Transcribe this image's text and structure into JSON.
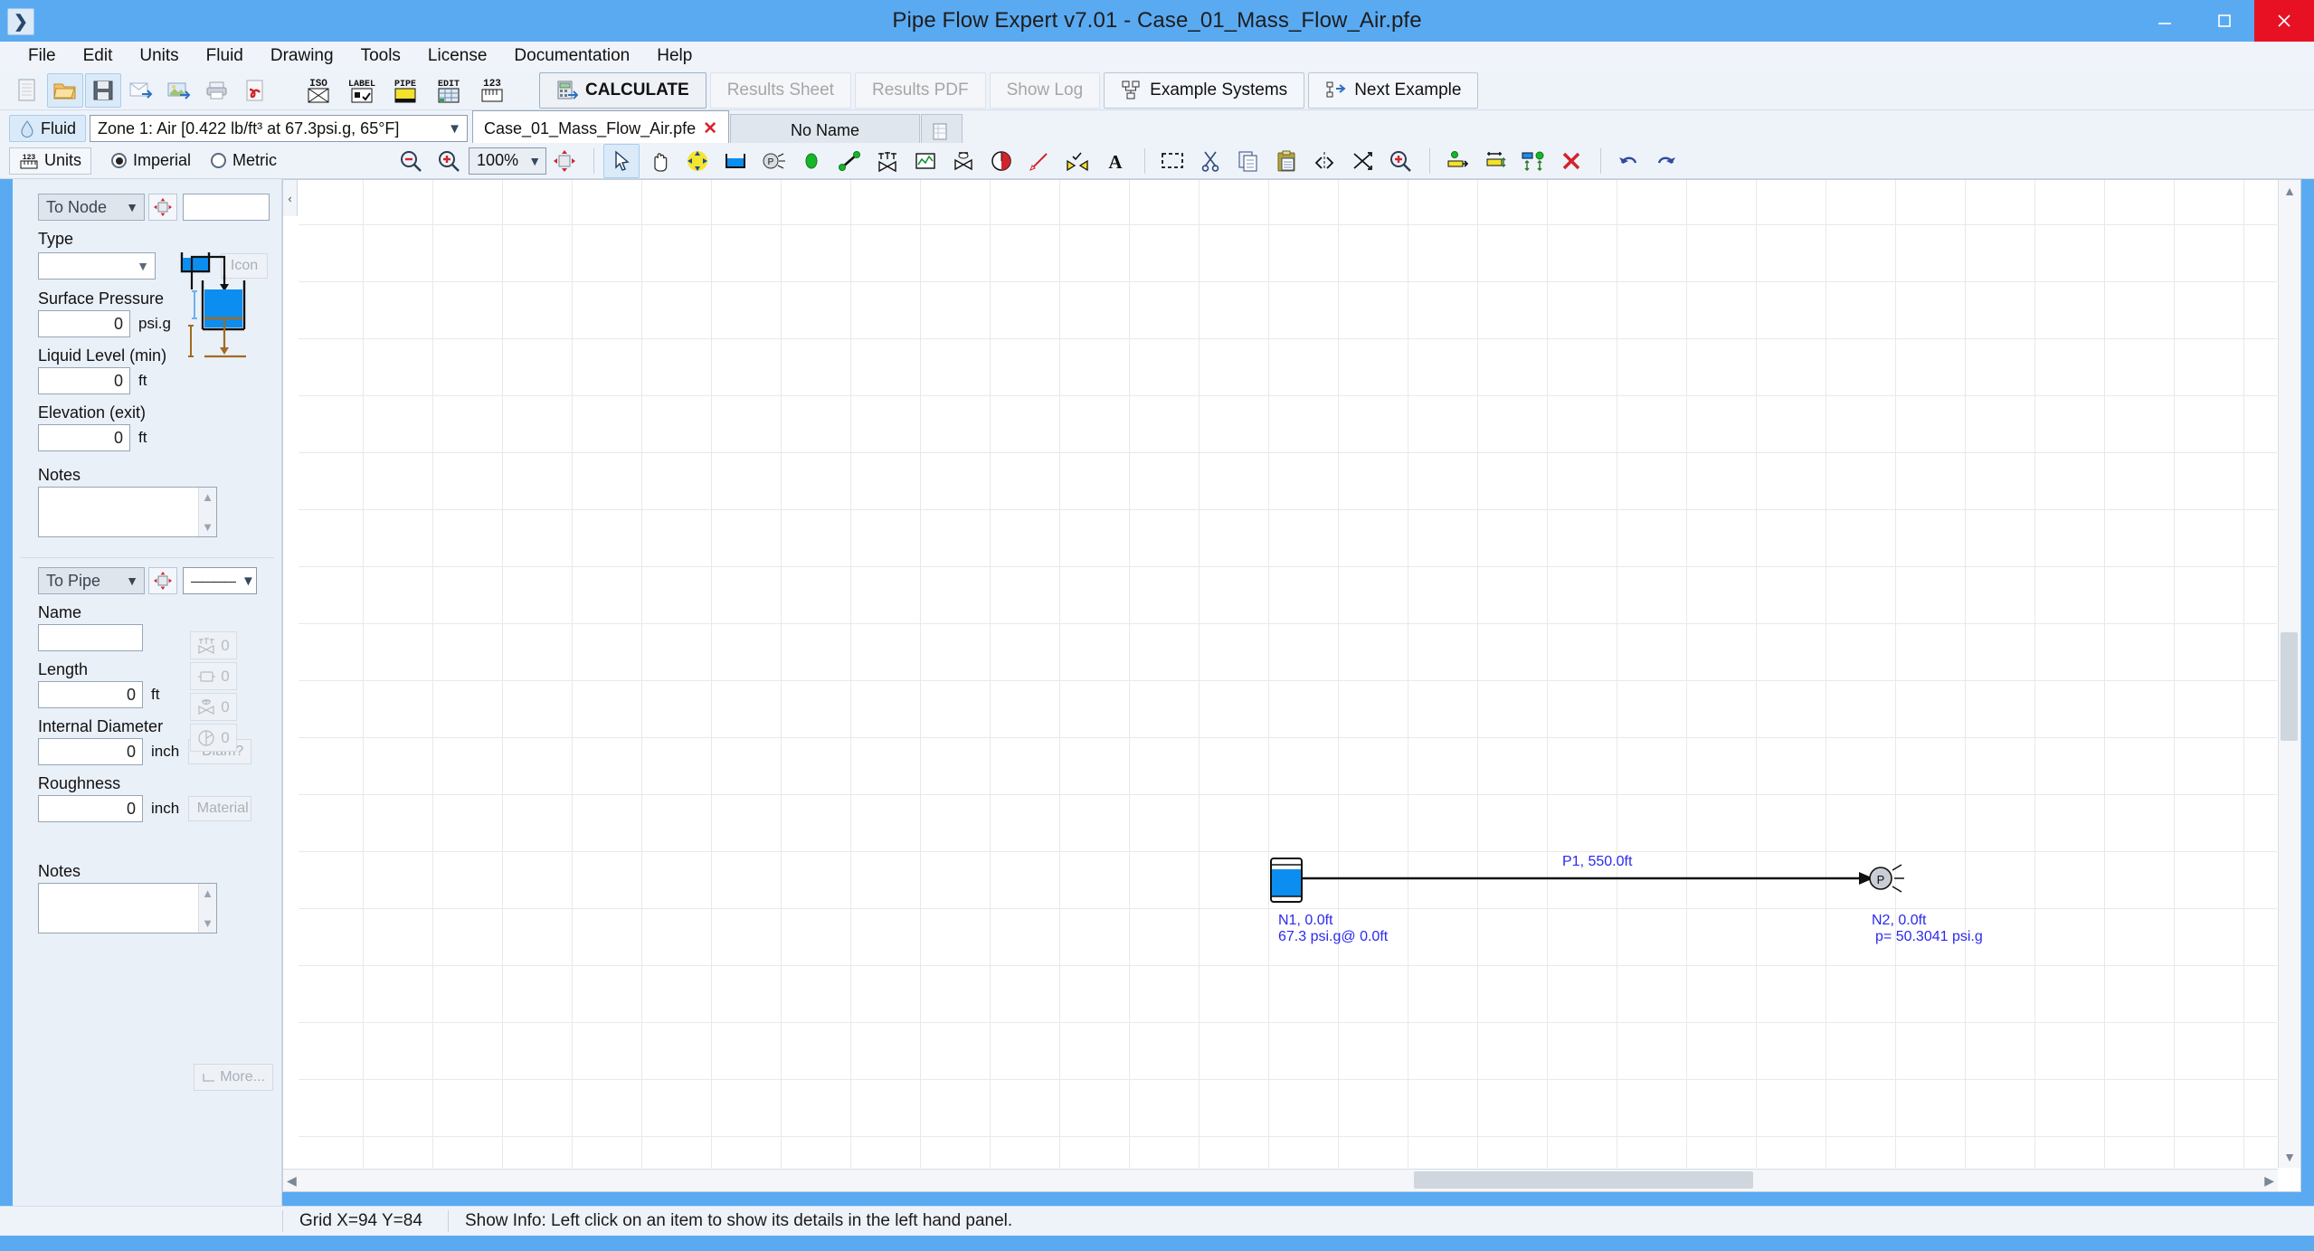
{
  "window": {
    "title": "Pipe Flow Expert v7.01 - Case_01_Mass_Flow_Air.pfe",
    "app_icon": "app-icon",
    "minimize": "minimize-button",
    "maximize": "maximize-button",
    "close": "close-button"
  },
  "menu": {
    "items": [
      {
        "label": "File"
      },
      {
        "label": "Edit"
      },
      {
        "label": "Units"
      },
      {
        "label": "Fluid"
      },
      {
        "label": "Drawing"
      },
      {
        "label": "Tools"
      },
      {
        "label": "License"
      },
      {
        "label": "Documentation"
      },
      {
        "label": "Help"
      }
    ]
  },
  "toolbar_file": {
    "icons": [
      {
        "name": "new-file-icon",
        "glyph": "▦"
      },
      {
        "name": "open-folder-icon",
        "glyph": "📂"
      },
      {
        "name": "save-icon",
        "glyph": "💾"
      },
      {
        "name": "email-icon",
        "glyph": "✉"
      },
      {
        "name": "export-image-icon",
        "glyph": "🖼"
      },
      {
        "name": "print-icon",
        "glyph": "🖨"
      },
      {
        "name": "pdf-icon",
        "glyph": "📄"
      }
    ],
    "mode_icons": [
      {
        "name": "iso-view-icon",
        "label": "ISO"
      },
      {
        "name": "label-view-icon",
        "label": "LABEL"
      },
      {
        "name": "pipe-view-icon",
        "label": "PIPE"
      },
      {
        "name": "edit-view-icon",
        "label": "EDIT"
      },
      {
        "name": "units-view-icon",
        "label": "123"
      }
    ]
  },
  "actions": {
    "calculate": "CALCULATE",
    "results_sheet": "Results Sheet",
    "results_pdf": "Results PDF",
    "show_log": "Show Log",
    "example_systems": "Example Systems",
    "next_example": "Next Example"
  },
  "fluid_bar": {
    "fluid_label": "Fluid",
    "fluid_value": "Zone 1: Air [0.422 lb/ft³ at 67.3psi.g, 65°F]"
  },
  "tabs": {
    "items": [
      {
        "label": "Case_01_Mass_Flow_Air.pfe",
        "active": true,
        "close": "✕"
      },
      {
        "label": "No Name",
        "active": false
      }
    ],
    "add_tab": "new-tab-icon"
  },
  "units_bar": {
    "units_button": "Units",
    "imperial": "Imperial",
    "metric": "Metric",
    "selected_units": "Imperial",
    "zoom_out": "zoom-out-icon",
    "zoom_in": "zoom-in-icon",
    "zoom_level": "100%",
    "fit_view": "fit-to-view-icon"
  },
  "draw_tools": {
    "items": [
      {
        "name": "select-pointer-tool",
        "selected": true
      },
      {
        "name": "pan-hand-tool",
        "selected": false
      },
      {
        "name": "move-node-tool",
        "selected": false
      },
      {
        "name": "tank-tool",
        "selected": false
      },
      {
        "name": "end-pressure-tool",
        "selected": false
      },
      {
        "name": "join-point-tool",
        "selected": false
      },
      {
        "name": "pipe-tool",
        "selected": false
      },
      {
        "name": "valve-tool",
        "selected": false
      },
      {
        "name": "component-tool",
        "selected": false
      },
      {
        "name": "control-valve-tool",
        "selected": false
      },
      {
        "name": "pump-tool",
        "selected": false
      },
      {
        "name": "flow-arrow-tool",
        "selected": false
      },
      {
        "name": "check-valve-tool",
        "selected": false
      },
      {
        "name": "text-tool",
        "selected": false
      },
      {
        "name": "marquee-select-tool",
        "selected": false
      },
      {
        "name": "cut-icon",
        "selected": false
      },
      {
        "name": "copy-icon",
        "selected": false
      },
      {
        "name": "paste-icon",
        "selected": false
      },
      {
        "name": "flip-horizontal-icon",
        "selected": false
      },
      {
        "name": "flip-vertical-icon",
        "selected": false
      },
      {
        "name": "zoom-area-icon",
        "selected": false
      },
      {
        "name": "align-horizontal-icon",
        "selected": false
      },
      {
        "name": "distribute-horizontal-icon",
        "selected": false
      },
      {
        "name": "distribute-vertical-icon",
        "selected": false
      },
      {
        "name": "delete-icon",
        "selected": false
      },
      {
        "name": "undo-icon",
        "selected": false
      },
      {
        "name": "redo-icon",
        "selected": false
      }
    ]
  },
  "node_panel": {
    "selector": "To Node",
    "locate_icon": "locate-node-icon",
    "name_value": "",
    "type_label": "Type",
    "type_value": "",
    "tank_icon": "tank-icon",
    "icon_button": "Icon",
    "surface_pressure_label": "Surface Pressure",
    "surface_pressure_value": "0",
    "surface_pressure_unit": "psi.g",
    "liquid_level_label": "Liquid Level (min)",
    "liquid_level_value": "0",
    "liquid_level_unit": "ft",
    "elevation_label": "Elevation (exit)",
    "elevation_value": "0",
    "elevation_unit": "ft",
    "notes_label": "Notes",
    "notes_value": ""
  },
  "pipe_panel": {
    "selector": "To Pipe",
    "locate_icon": "locate-pipe-icon",
    "line_style": "————",
    "name_label": "Name",
    "name_value": "",
    "length_label": "Length",
    "length_value": "0",
    "length_unit": "ft",
    "internal_diameter_label": "Internal Diameter",
    "internal_diameter_value": "0",
    "internal_diameter_unit": "inch",
    "diam_button": "Diam?",
    "roughness_label": "Roughness",
    "roughness_value": "0",
    "roughness_unit": "inch",
    "material_button": "Material",
    "more_button": "More...",
    "notes_label": "Notes",
    "notes_value": "",
    "counters": [
      {
        "name": "fittings-count",
        "value": "0"
      },
      {
        "name": "components-count",
        "value": "0"
      },
      {
        "name": "control-valves-count",
        "value": "0"
      },
      {
        "name": "pumps-count",
        "value": "0"
      }
    ]
  },
  "canvas": {
    "collapse_handle": "‹",
    "elements": {
      "tank_node": "tank-node-n1",
      "pipe": "pipe-p1",
      "end_pressure_node": "end-pressure-node-n2"
    },
    "labels": {
      "pipe_label": "P1, 550.0ft",
      "n1_line1": "N1, 0.0ft",
      "n1_line2": "67.3 psi.g@ 0.0ft",
      "n2_line1": "N2, 0.0ft",
      "n2_line2": "p= 50.3041 psi.g"
    }
  },
  "status_bar": {
    "grid_coords": "Grid  X=94  Y=84",
    "info_message": "Show Info: Left click on an item to show its details in the left hand panel."
  },
  "colors": {
    "title_bar": "#5aaaf2",
    "close_button": "#e81123",
    "label_blue": "#2a2aee",
    "tank_blue": "#0b8ef0",
    "panel_bg": "#eaf0f8",
    "accent_red": "#d9232d"
  }
}
